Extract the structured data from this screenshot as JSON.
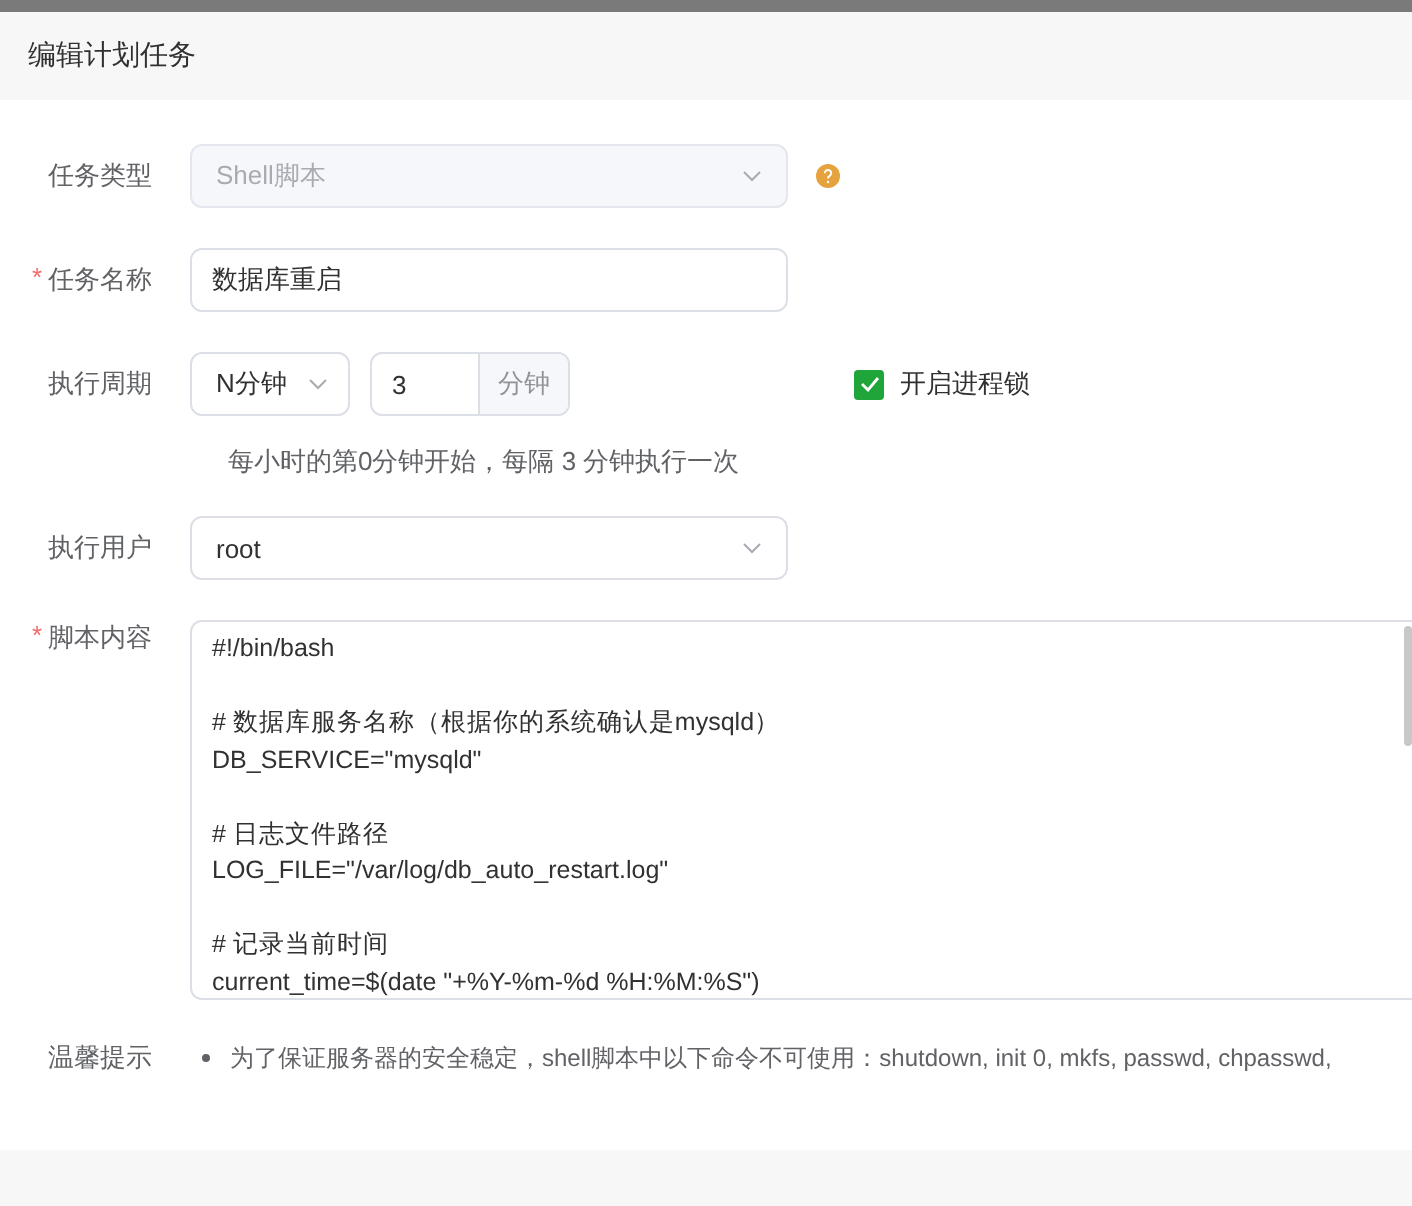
{
  "dialog": {
    "title": "编辑计划任务"
  },
  "form": {
    "task_type": {
      "label": "任务类型",
      "value": "Shell脚本",
      "disabled": true
    },
    "task_name": {
      "label": "任务名称",
      "required_mark": "*",
      "value": "数据库重启"
    },
    "period": {
      "label": "执行周期",
      "mode": "N分钟",
      "value": "3",
      "unit": "分钟",
      "hint": "每小时的第0分钟开始，每隔 3 分钟执行一次",
      "lock": {
        "label": "开启进程锁",
        "checked": true
      }
    },
    "user": {
      "label": "执行用户",
      "value": "root"
    },
    "script": {
      "label": "脚本内容",
      "required_mark": "*",
      "blocks": [
        [
          "#!/bin/bash"
        ],
        [
          "# 数据库服务名称（根据你的系统确认是mysqld）",
          "DB_SERVICE=\"mysqld\""
        ],
        [
          "# 日志文件路径",
          "LOG_FILE=\"/var/log/db_auto_restart.log\""
        ],
        [
          "# 记录当前时间",
          "current_time=$(date \"+%Y-%m-%d %H:%M:%S\")"
        ]
      ]
    },
    "tips": {
      "label": "温馨提示",
      "items": [
        "为了保证服务器的安全稳定，shell脚本中以下命令不可使用：shutdown, init 0, mkfs, passwd, chpasswd,"
      ]
    }
  }
}
